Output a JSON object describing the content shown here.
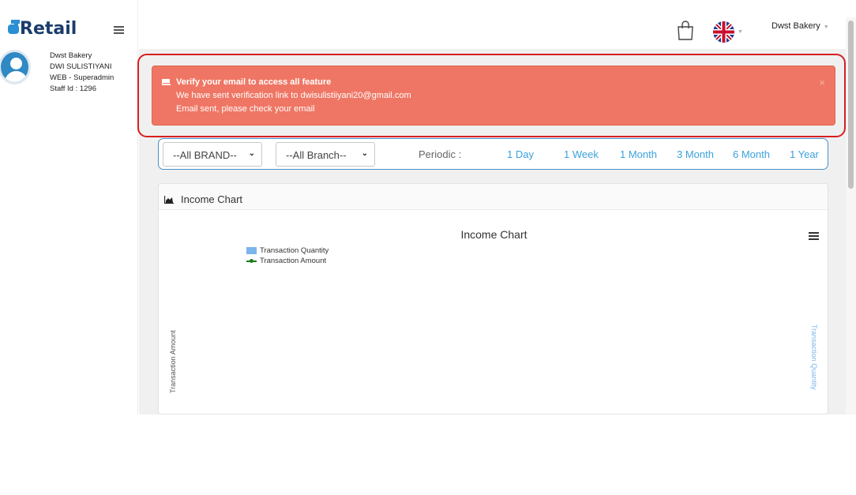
{
  "app": {
    "logo_text": "dRetail"
  },
  "sidebar": {
    "user": {
      "company": "Dwst Bakery",
      "name": "DWI SULISTIYANI",
      "role": "WEB - Superadmin",
      "staff_id": "Staff Id : 1296"
    }
  },
  "header": {
    "account_name": "Dwst Bakery",
    "language_flag": "uk-flag-icon",
    "cart_icon": "shopping-bag-icon"
  },
  "alert": {
    "title": "Verify your email to access all feature",
    "line1": "We have sent verification link to dwisulistiiyani20@gmail.com",
    "line2": "Email sent, please check your email",
    "close": "×",
    "color": "#ef7664"
  },
  "filters": {
    "brand_selected": "--All BRAND--",
    "branch_selected": "--All Branch--",
    "periodic_label": "Periodic :",
    "periods": [
      "1 Day",
      "1 Week",
      "1 Month",
      "3 Month",
      "6 Month",
      "1 Year"
    ]
  },
  "card": {
    "title": "Income Chart"
  },
  "chart_data": {
    "type": "bar",
    "title": "Income Chart",
    "series": [
      {
        "name": "Transaction Quantity",
        "type": "bar",
        "color": "#7cb5ec",
        "values": []
      },
      {
        "name": "Transaction Amount",
        "type": "line",
        "color": "#1d7a1d",
        "values": []
      }
    ],
    "categories": [],
    "ylabel": "Transaction Amount",
    "ylabel_right": "Transaction Quantity",
    "legend": "top-left"
  },
  "colors": {
    "accent": "#3aa1db",
    "highlight_border": "#d81f1f"
  }
}
